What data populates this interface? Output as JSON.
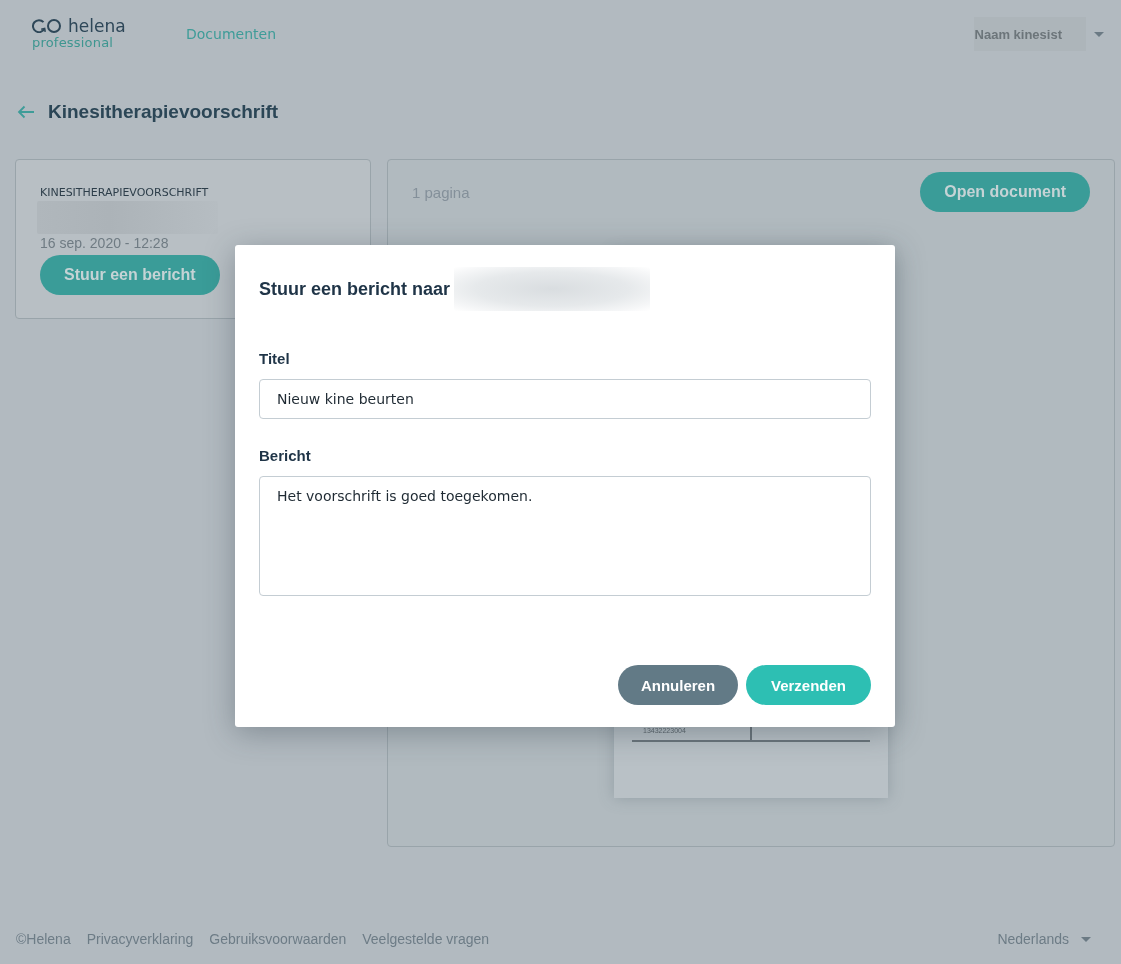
{
  "header": {
    "logo": {
      "name": "helena",
      "tagline": "professional"
    },
    "nav": [
      {
        "label": "Documenten",
        "selected": true
      }
    ],
    "user_menu": {
      "label": "Naam kinesist"
    }
  },
  "page": {
    "title": "Kinesitherapievoorschrift"
  },
  "document_card": {
    "type_label": "KINESITHERAPIEVOORSCHRIFT",
    "date": "16 sep. 2020 - 12:28",
    "button": "Stuur een bericht"
  },
  "preview": {
    "page_count": "1 pagina",
    "button": "Open document",
    "visible_text": "13432223004"
  },
  "dialog": {
    "title": "Stuur een bericht naar",
    "fields": [
      {
        "label": "Titel",
        "kind": "input",
        "value": "Nieuw kine beurten"
      },
      {
        "label": "Bericht",
        "kind": "textarea",
        "value": "Het voorschrift is goed toegekomen."
      }
    ],
    "buttons": [
      {
        "label": "Annuleren",
        "kind": "secondary"
      },
      {
        "label": "Verzenden",
        "kind": "primary"
      }
    ]
  },
  "footer": {
    "copyright": "©Helena",
    "links": [
      "Privacyverklaring",
      "Gebruiksvoorwaarden",
      "Veelgestelde vragen"
    ],
    "language": "Nederlands"
  }
}
